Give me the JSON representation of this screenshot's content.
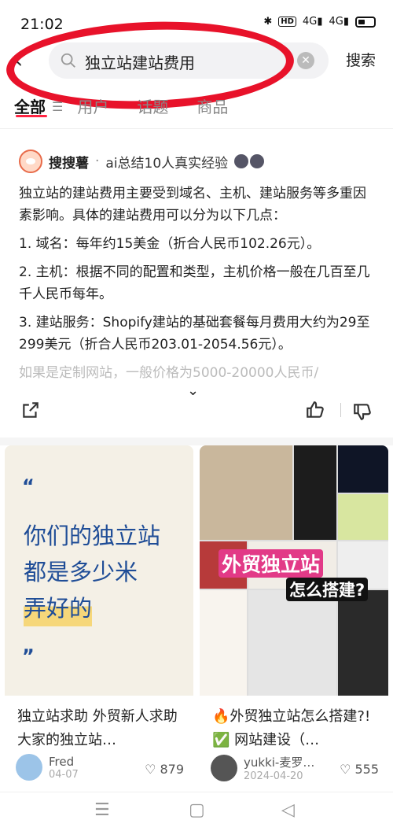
{
  "status_bar": {
    "time": "21:02",
    "hd_badge": "HD",
    "net1": "4G",
    "net2": "4G"
  },
  "search": {
    "query": "独立站建站费用",
    "submit_label": "搜索"
  },
  "tabs": [
    {
      "label": "全部"
    },
    {
      "label": "用户"
    },
    {
      "label": "话题"
    },
    {
      "label": "商品"
    }
  ],
  "ai_answer": {
    "name": "搜搜薯",
    "separator": "·",
    "subtitle": "ai总结10人真实经验",
    "intro": "独立站的建站费用主要受到域名、主机、建站服务等多重因素影响。具体的建站费用可以分为以下几点：",
    "points": [
      "1. 域名：每年约15美金（折合人民币102.26元）。",
      "2. 主机：根据不同的配置和类型，主机价格一般在几百至几千人民币每年。",
      "3. 建站服务：Shopify建站的基础套餐每月费用大约为29至299美元（折合人民币203.01-2054.56元）。"
    ],
    "faded": "如果是定制网站，一般价格为5000-20000人民币/"
  },
  "feed": [
    {
      "cover_lines": [
        "你们的独立站",
        "都是多少米",
        "弄好的"
      ],
      "title": "独立站求助 外贸新人求助 大家的独立站…",
      "author": "Fred",
      "date": "04-07",
      "likes": "879"
    },
    {
      "cover_title": "外贸独立站",
      "cover_sub": "怎么搭建?",
      "title": "🔥外贸独立站怎么搭建?! ✅ 网站建设（…",
      "author": "yukki-麦罗…",
      "date": "2024-04-20",
      "likes": "555"
    }
  ],
  "colors": {
    "accent": "#ff2442",
    "annotation": "#e8122a",
    "cover_text": "#1f4d97"
  }
}
